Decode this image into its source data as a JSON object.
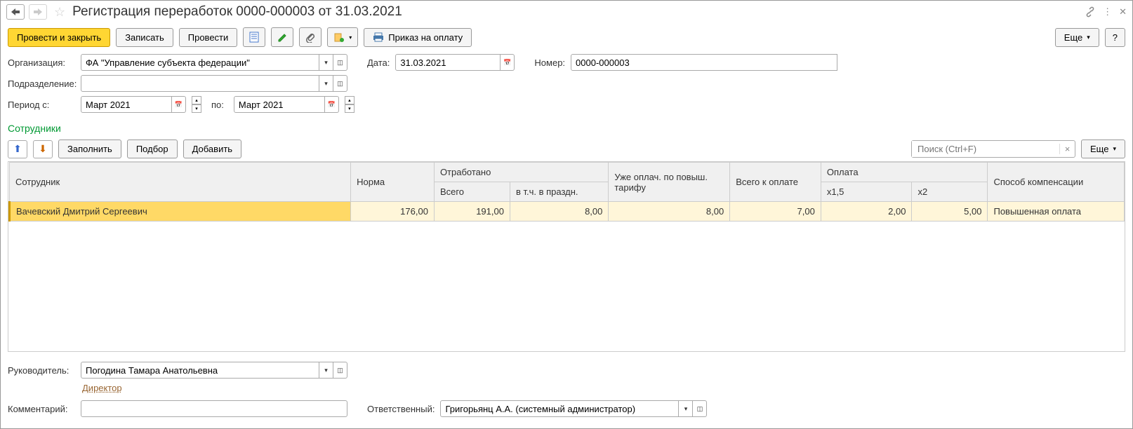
{
  "title": "Регистрация переработок 0000-000003 от 31.03.2021",
  "toolbar": {
    "post_close": "Провести и закрыть",
    "save": "Записать",
    "post": "Провести",
    "print_order": "Приказ на оплату",
    "more": "Еще",
    "help": "?"
  },
  "form": {
    "org_label": "Организация:",
    "org_value": "ФА \"Управление субъекта федерации\"",
    "date_label": "Дата:",
    "date_value": "31.03.2021",
    "number_label": "Номер:",
    "number_value": "0000-000003",
    "dept_label": "Подразделение:",
    "dept_value": "",
    "period_from_label": "Период с:",
    "period_from": "Март 2021",
    "period_to_label": "по:",
    "period_to": "Март 2021"
  },
  "section": "Сотрудники",
  "table_toolbar": {
    "fill": "Заполнить",
    "select": "Подбор",
    "add": "Добавить",
    "search_placeholder": "Поиск (Ctrl+F)",
    "more": "Еще"
  },
  "columns": {
    "employee": "Сотрудник",
    "norm": "Норма",
    "worked": "Отработано",
    "worked_total": "Всего",
    "worked_holiday": "в т.ч. в праздн.",
    "already_paid": "Уже оплач. по повыш. тарифу",
    "total_pay": "Всего к оплате",
    "payment": "Оплата",
    "x15": "x1,5",
    "x2": "x2",
    "comp": "Способ компенсации"
  },
  "rows": [
    {
      "employee": "Вачевский Дмитрий Сергеевич",
      "norm": "176,00",
      "total": "191,00",
      "holiday": "8,00",
      "already": "8,00",
      "topay": "7,00",
      "p15": "2,00",
      "p2": "5,00",
      "comp": "Повышенная оплата"
    }
  ],
  "footer": {
    "manager_label": "Руководитель:",
    "manager_value": "Погодина Тамара Анатольевна",
    "position": "Директор",
    "comment_label": "Комментарий:",
    "comment_value": "",
    "resp_label": "Ответственный:",
    "resp_value": "Григорьянц А.А. (системный администратор)"
  }
}
